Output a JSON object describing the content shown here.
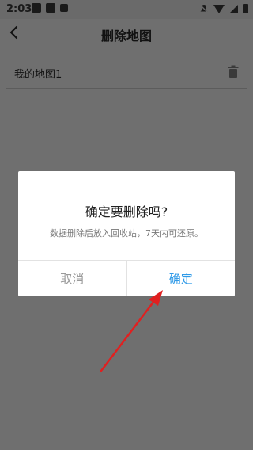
{
  "status_bar": {
    "time": "2:03"
  },
  "header": {
    "title": "删除地图",
    "back_icon": "back-chevron-icon"
  },
  "list": {
    "items": [
      {
        "label": "我的地图1",
        "icon": "trash-icon"
      }
    ]
  },
  "dialog": {
    "title": "确定要删除吗?",
    "message": "数据删除后放入回收站，7天内可还原。",
    "cancel_label": "取消",
    "confirm_label": "确定"
  },
  "colors": {
    "confirm_button": "#2f9ae8",
    "cancel_button": "#9a9a9a",
    "annotation_arrow": "#e02020"
  }
}
